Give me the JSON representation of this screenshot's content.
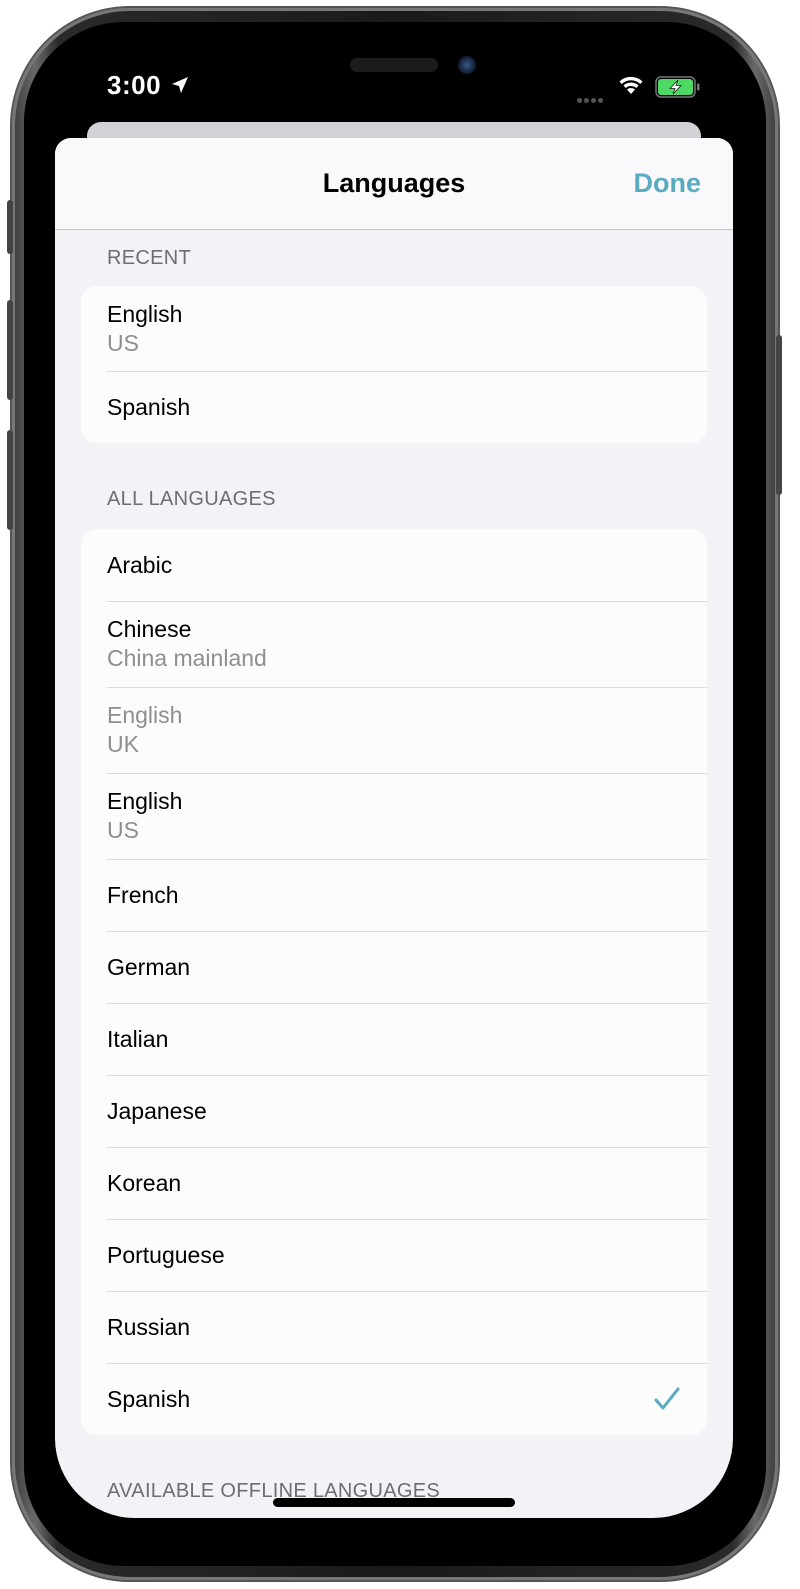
{
  "status_bar": {
    "time": "3:00",
    "icons": [
      "location-arrow-icon",
      "cellular-signal-icon",
      "wifi-icon",
      "battery-charging-icon"
    ]
  },
  "colors": {
    "accent": "#5aabc0",
    "battery": "#4cd964",
    "secondary_text": "#8e8e93",
    "section_header": "#6d6d72"
  },
  "nav": {
    "title": "Languages",
    "done_label": "Done"
  },
  "sections": [
    {
      "header": "RECENT",
      "items": [
        {
          "title": "English",
          "subtitle": "US"
        },
        {
          "title": "Spanish"
        }
      ]
    },
    {
      "header": "ALL LANGUAGES",
      "items": [
        {
          "title": "Arabic"
        },
        {
          "title": "Chinese",
          "subtitle": "China mainland"
        },
        {
          "title": "English",
          "subtitle": "UK",
          "disabled": true
        },
        {
          "title": "English",
          "subtitle": "US"
        },
        {
          "title": "French"
        },
        {
          "title": "German"
        },
        {
          "title": "Italian"
        },
        {
          "title": "Japanese"
        },
        {
          "title": "Korean"
        },
        {
          "title": "Portuguese"
        },
        {
          "title": "Russian"
        },
        {
          "title": "Spanish",
          "selected": true,
          "accessory": "checkmark-icon"
        }
      ]
    },
    {
      "header": "AVAILABLE OFFLINE LANGUAGES",
      "items": []
    }
  ]
}
